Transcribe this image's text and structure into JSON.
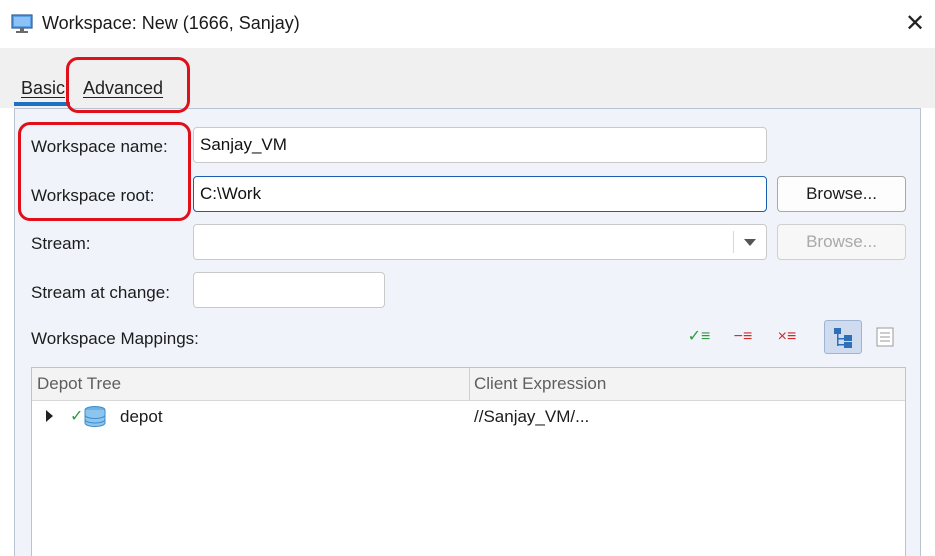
{
  "window": {
    "title": "Workspace: New (1666,  Sanjay)",
    "close_glyph": "✕"
  },
  "tabs": [
    {
      "label": "Basic",
      "selected": true
    },
    {
      "label": "Advanced",
      "selected": false
    }
  ],
  "form": {
    "workspace_name_label": "Workspace name:",
    "workspace_name_value": "Sanjay_VM",
    "workspace_root_label": "Workspace root:",
    "workspace_root_value": "C:\\Work",
    "browse_label": "Browse...",
    "stream_label": "Stream:",
    "stream_value": "",
    "stream_browse_label": "Browse...",
    "stream_at_change_label": "Stream at change:",
    "stream_at_change_value": ""
  },
  "mappings": {
    "label": "Workspace Mappings:",
    "toolbar": [
      {
        "icon": "include-mapping-icon",
        "glyph": "✓≡",
        "color": "#2e9a3e"
      },
      {
        "icon": "exclude-mapping-icon",
        "glyph": "−≡",
        "color": "#d02b2b"
      },
      {
        "icon": "remove-mapping-icon",
        "glyph": "×≡",
        "color": "#d02b2b"
      },
      {
        "icon": "tree-view-icon",
        "active": true
      },
      {
        "icon": "text-view-icon",
        "active": false
      }
    ],
    "columns": [
      "Depot Tree",
      "Client Expression"
    ],
    "rows": [
      {
        "name": "depot",
        "expression": "//Sanjay_VM/...",
        "included": true,
        "icon": "depot-database-icon"
      }
    ]
  },
  "annotation_color": "#e0101a",
  "accent_color": "#1e6fc6"
}
